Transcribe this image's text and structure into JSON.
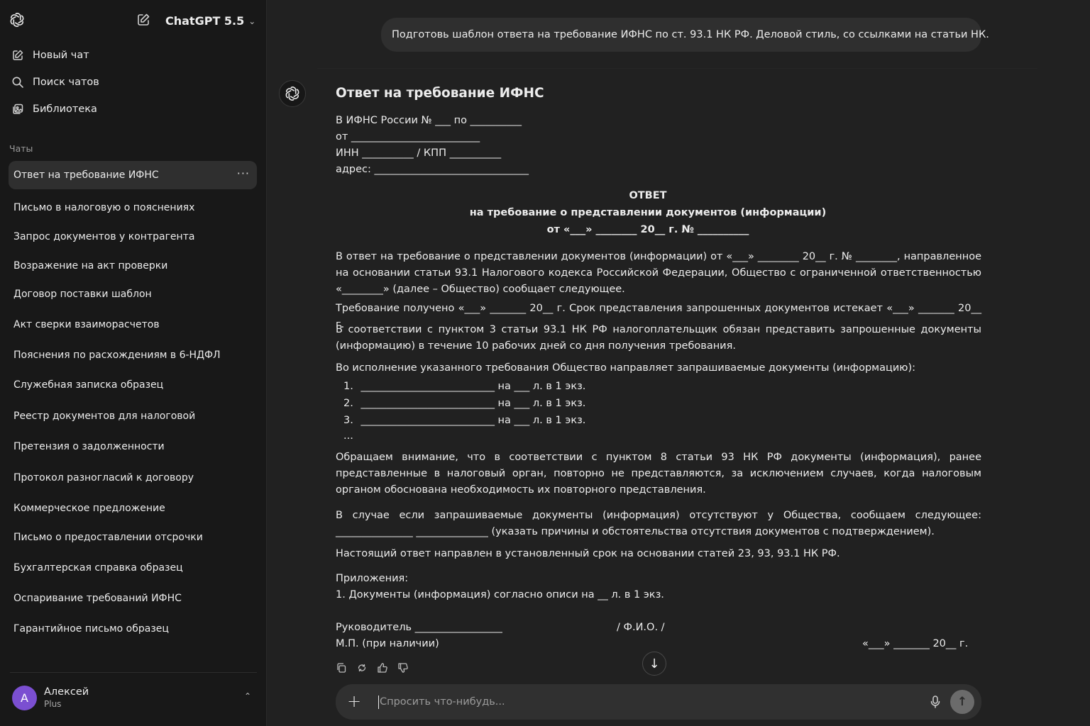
{
  "sidebar": {
    "model_name": "ChatGPT 5.5",
    "actions": [
      {
        "label": "Новый чат",
        "icon": "edit-icon"
      },
      {
        "label": "Поиск чатов",
        "icon": "search-icon"
      },
      {
        "label": "Библиотека",
        "icon": "library-icon"
      }
    ],
    "section_title": "Чаты",
    "chats": [
      "Ответ на требование ИФНС",
      "Письмо в налоговую о пояснениях",
      "Запрос документов у контрагента",
      "Возражение на акт проверки",
      "Договор поставки шаблон",
      "Акт сверки взаиморасчетов",
      "Пояснения по расхождениям в 6-НДФЛ",
      "Служебная записка образец",
      "Реестр документов для налоговой",
      "Претензия о задолженности",
      "Протокол разногласий к договору",
      "Коммерческое предложение",
      "Письмо о предоставлении отсрочки",
      "Бухгалтерская справка образец",
      "Оспаривание требований ИФНС",
      "Гарантийное письмо образец"
    ],
    "more_label": "···",
    "user": {
      "initial": "A",
      "name": "Алексей",
      "plan": "Plus"
    }
  },
  "conversation": {
    "user_message": "Подготовь шаблон ответа на требование ИФНС по ст. 93.1 НК РФ. Деловой стиль, со ссылками на статьи НК.",
    "doc": {
      "title": "Ответ на требование ИФНС",
      "header_lines": [
        "В ИФНС России № ___ по __________",
        "от _________________________",
        "ИНН __________ / КПП __________",
        "адрес: ______________________________"
      ],
      "heading1": "ОТВЕТ",
      "heading2": "на требование о представлении документов (информации)",
      "heading3": "от «___» ________ 20__ г. № __________",
      "para1": "В ответ на требование о представлении документов (информации) от «___» ________ 20__ г. № ________, направленное на основании статьи 93.1 Налогового кодекса Российской Федерации, Общество с ограниченной ответственностью «________» (далее – Общество) сообщает следующее.",
      "para2": "Требование получено «___» _______ 20__ г. Срок представления запрошенных документов истекает «___» _______ 20__ г.",
      "para3": "В соответствии с пунктом 3 статьи 93.1 НК РФ налогоплательщик обязан представить запрошенные документы (информацию) в течение 10 рабочих дней со дня получения требования.",
      "para4": "Во исполнение указанного требования Общество направляет запрашиваемые документы (информацию):",
      "list": [
        {
          "num": "1.",
          "text": "__________________________ на ___ л. в 1 экз."
        },
        {
          "num": "2.",
          "text": "__________________________ на ___ л. в 1 экз."
        },
        {
          "num": "3.",
          "text": "__________________________ на ___ л. в 1 экз."
        }
      ],
      "ellipsis": "...",
      "para5": "Обращаем внимание, что в соответствии с пунктом 8 статьи 93 НК РФ документы (информация), ранее представленные в налоговый орган, повторно не представляются, за исключением случаев, когда налоговым органом обоснована необходимость их повторного представления.",
      "para6": "В случае если запрашиваемые документы (информация) отсутствуют у Общества, сообщаем следующее: _______________ ______________ (указать причины и обстоятельства отсутствия документов с подтверждением).",
      "para7": "Настоящий ответ направлен в установленный срок на основании статей 23, 93, 93.1 НК РФ.",
      "attachments_title": "Приложения:",
      "attachment_1": "1.  Документы (информация) согласно описи на __ л. в 1 экз.",
      "signer": "Руководитель _________________",
      "fio": "/ Ф.И.О. /",
      "stamp": "М.П. (при наличии)",
      "date": "«___» _______ 20__ г."
    }
  },
  "composer": {
    "placeholder": "Спросить что-нибудь..."
  }
}
